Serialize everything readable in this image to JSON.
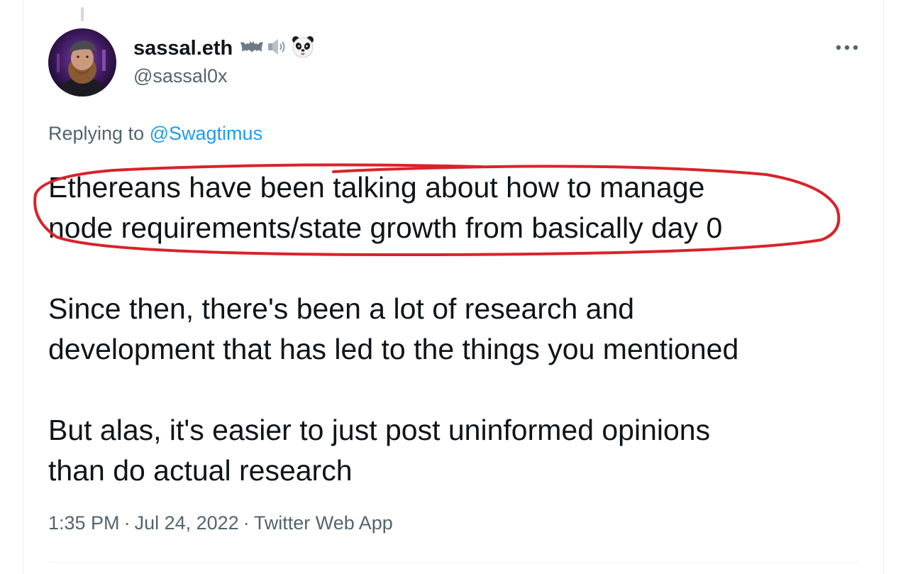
{
  "author": {
    "display_name": "sassal.eth",
    "name_emojis": [
      "bat-icon",
      "speaker-icon",
      "panda-icon"
    ],
    "handle": "@sassal0x"
  },
  "reply": {
    "prefix": "Replying to",
    "mention": "@Swagtimus"
  },
  "tweet": {
    "paragraph1_line1": "Ethereans have been talking about how to manage",
    "paragraph1_line2": "node requirements/state growth from basically day 0",
    "paragraph2_line1": "Since then, there's been a lot of research and",
    "paragraph2_line2": "development that has led to the things you mentioned",
    "paragraph3_line1": "But alas, it's easier to just post uninformed opinions",
    "paragraph3_line2": "than do actual research"
  },
  "meta": {
    "time": "1:35 PM",
    "sep1": "·",
    "date": "Jul 24, 2022",
    "sep2": "·",
    "source": "Twitter Web App"
  },
  "colors": {
    "text_primary": "#0f1419",
    "text_secondary": "#536471",
    "link": "#1d9bf0",
    "annotation_ellipse": "#d8232a"
  }
}
